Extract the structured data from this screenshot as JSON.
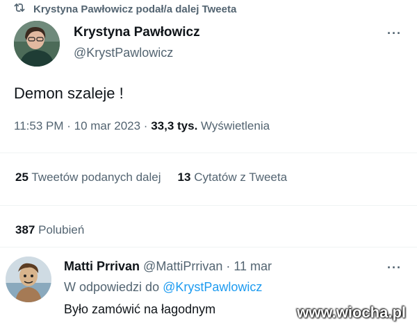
{
  "retweet_bar": {
    "icon": "retweet-icon",
    "text": "Krystyna Pawłowicz podał/a dalej Tweeta"
  },
  "author": {
    "name": "Krystyna Pawłowicz",
    "handle": "@KrystPawlowicz",
    "more_icon": "more-icon",
    "more_label": "···"
  },
  "tweet": {
    "text": "Demon szaleje !",
    "time": "11:53 PM",
    "sep1": " · ",
    "date": "10 mar 2023",
    "sep2": " · ",
    "views_count": "33,3 tys.",
    "views_label": "Wyświetlenia"
  },
  "stats": {
    "retweets_count": "25",
    "retweets_label": "Tweetów podanych dalej",
    "quotes_count": "13",
    "quotes_label": "Cytatów z Tweeta",
    "likes_count": "387",
    "likes_label": "Polubień"
  },
  "reply": {
    "name": "Matti Prrivan",
    "handle": "@MattiPrrivan",
    "sep": " · ",
    "date": "11 mar",
    "more_label": "···",
    "reply_prefix": "W odpowiedzi do",
    "reply_mention": "@KrystPawlowicz",
    "text": "Było zamówić na łagodnym"
  },
  "watermark": "www.wiocha.pl",
  "colors": {
    "text": "#0f1419",
    "secondary": "#536471",
    "link": "#1d9bf0",
    "divider": "#eff3f4"
  }
}
